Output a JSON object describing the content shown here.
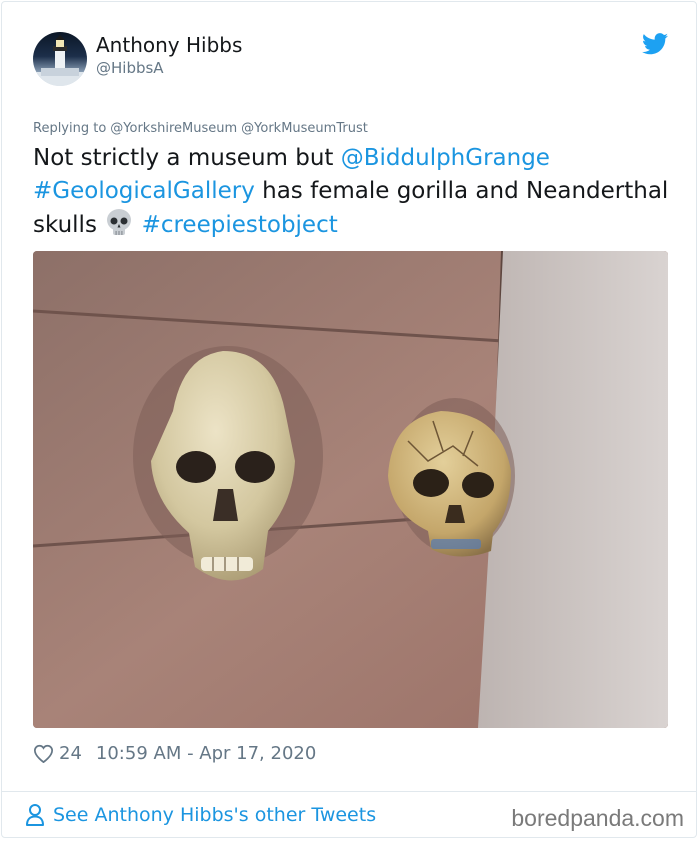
{
  "author": {
    "display_name": "Anthony Hibbs",
    "handle": "@HibbsA",
    "avatar_icon": "lighthouse-avatar"
  },
  "brand_icon": "twitter-bird-icon",
  "reply": {
    "prefix": "Replying to",
    "mentions": [
      "@YorkshireMuseum",
      "@YorkMuseumTrust"
    ]
  },
  "tweet": {
    "text_part1": "Not strictly a museum but ",
    "mention": "@BiddulphGrange",
    "hashtag1": "#GeologicalGallery",
    "text_part2": " has female gorilla and Neanderthal skulls ",
    "emoji": "skull-emoji",
    "hashtag2": "#creepiestobject"
  },
  "meta": {
    "like_count": "24",
    "timestamp": "10:59 AM - Apr 17, 2020"
  },
  "footer": {
    "other_tweets_label": "See Anthony Hibbs's other Tweets",
    "watermark": "boredpanda.com"
  },
  "colors": {
    "link": "#1b95e0",
    "muted": "#657786",
    "text": "#14171a",
    "border": "#e1e8ed"
  }
}
